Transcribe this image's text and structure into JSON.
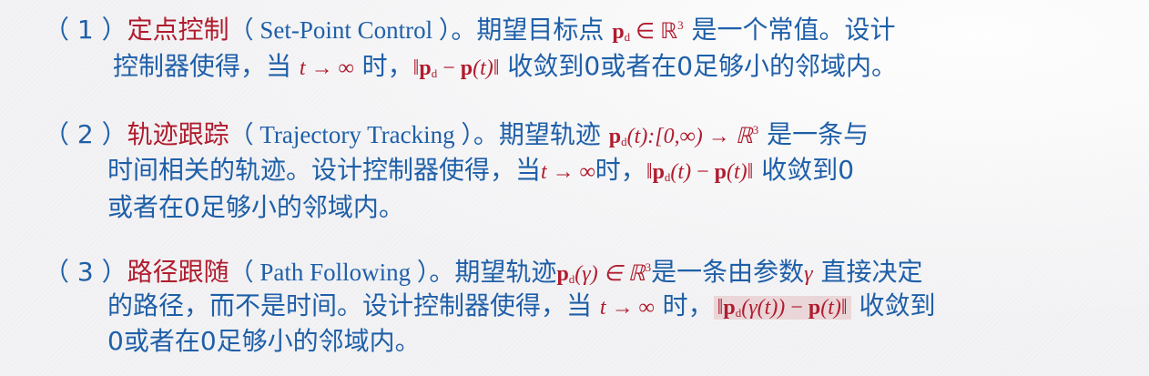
{
  "item1": {
    "num": "（ 1 ）",
    "kw": "定点控制",
    "en": "（ Set-Point Control ）",
    "t1": "。期望目标点 ",
    "m1": {
      "p": "p",
      "sub": "d",
      "rel": " ∈ ℝ",
      "sup": "3"
    },
    "t2": " 是一个常值。设计",
    "l2a": "控制器使得，当 ",
    "m2": "t → ∞",
    "l2b": " 时，",
    "m3": {
      "open": "‖",
      "p1": "p",
      "sub": "d",
      "mid": " − ",
      "p2": "p",
      "arg": "(t)",
      "close": "‖"
    },
    "l2c": " 收敛到0或者在0足够小的邻域内。"
  },
  "item2": {
    "num": "（ 2 ）",
    "kw": "轨迹跟踪",
    "en": "（ Trajectory Tracking ）",
    "t1": "。期望轨迹 ",
    "m1": {
      "p": "p",
      "sub": "d",
      "rest": "(t):[0,∞) → ℝ",
      "sup": "3"
    },
    "t2": " 是一条与",
    "l2a": "时间相关的轨迹。设计控制器使得，当",
    "m2": "t → ∞",
    "l2b": "时，",
    "m3": {
      "open": "‖",
      "p1": "p",
      "sub": "d",
      "a1": "(t)",
      "mid": " − ",
      "p2": "p",
      "a2": "(t)",
      "close": "‖"
    },
    "l2c": " 收敛到0",
    "l3": "或者在0足够小的邻域内。"
  },
  "item3": {
    "num": "（ 3 ）",
    "kw": "路径跟随",
    "en": "（ Path Following ）",
    "t1": "。期望轨迹",
    "m1": {
      "p": "p",
      "sub": "d",
      "rest": "(γ) ∈ ℝ",
      "sup": "3"
    },
    "t2": "是一条由参数",
    "gamma": "γ",
    "t3": " 直接决定",
    "l2a": "的路径，而不是时间。设计控制器使得，当 ",
    "m2": "t → ∞",
    "l2b": " 时，",
    "m3": {
      "open": "‖",
      "p1": "p",
      "sub": "d",
      "a1": "(γ(t))",
      "mid": " − ",
      "p2": "p",
      "a2": "(t)",
      "close": "‖"
    },
    "l2c": " 收敛到",
    "l3": "0或者在0足够小的邻域内。"
  }
}
